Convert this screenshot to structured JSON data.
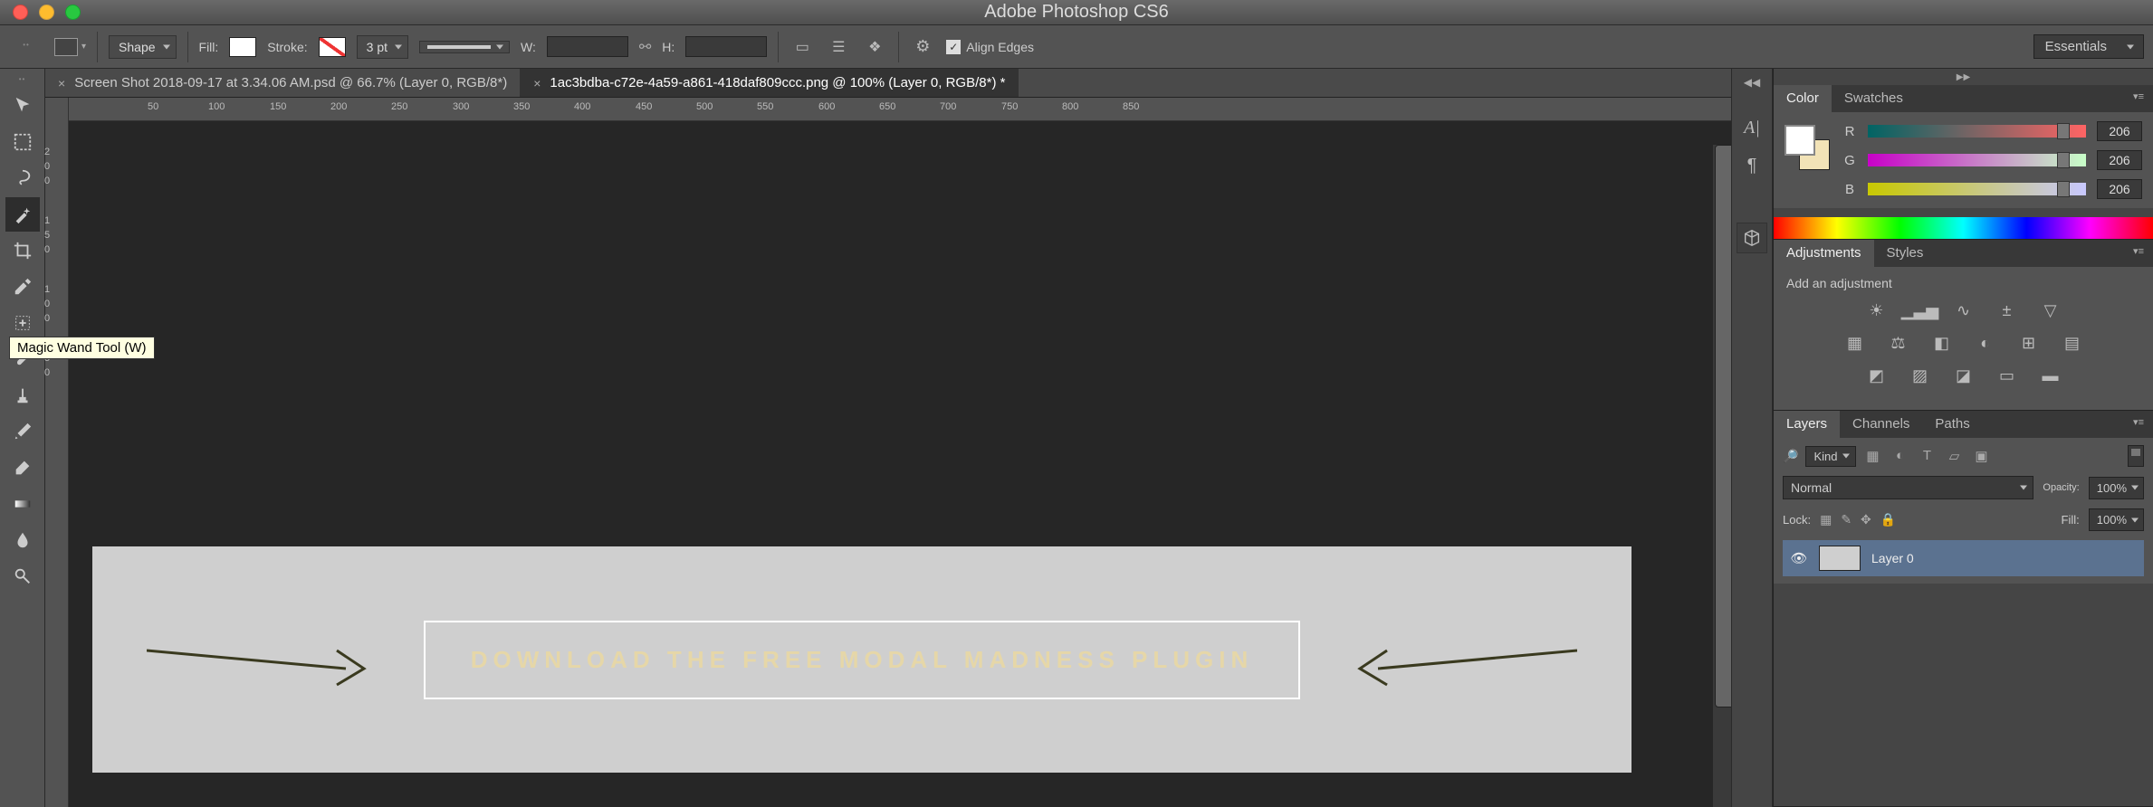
{
  "titlebar": {
    "title": "Adobe Photoshop CS6"
  },
  "options": {
    "shape_label": "Shape",
    "fill_label": "Fill:",
    "stroke_label": "Stroke:",
    "stroke_width": "3 pt",
    "w_label": "W:",
    "h_label": "H:",
    "align_edges": "Align Edges",
    "workspace": "Essentials"
  },
  "tabs": [
    {
      "label": "Screen Shot 2018-09-17 at 3.34.06 AM.psd @ 66.7% (Layer 0, RGB/8*)",
      "active": false
    },
    {
      "label": "1ac3bdba-c72e-4a59-a861-418daf809ccc.png @ 100% (Layer 0, RGB/8*) *",
      "active": true
    }
  ],
  "hruler_ticks": [
    "50",
    "100",
    "150",
    "200",
    "250",
    "300",
    "350",
    "400",
    "450",
    "500",
    "550",
    "600",
    "650",
    "700",
    "750",
    "800",
    "850"
  ],
  "vruler_ticks": [
    "2",
    "0",
    "0",
    "1",
    "5",
    "0",
    "1",
    "0",
    "0",
    "5",
    "0"
  ],
  "tooltip": "Magic Wand Tool (W)",
  "canvas": {
    "button_text": "DOWNLOAD THE FREE MODAL MADNESS PLUGIN"
  },
  "color_panel": {
    "tab_color": "Color",
    "tab_swatches": "Swatches",
    "r_label": "R",
    "g_label": "G",
    "b_label": "B",
    "r_val": "206",
    "g_val": "206",
    "b_val": "206"
  },
  "adjustments_panel": {
    "tab_adjustments": "Adjustments",
    "tab_styles": "Styles",
    "title": "Add an adjustment"
  },
  "layers_panel": {
    "tab_layers": "Layers",
    "tab_channels": "Channels",
    "tab_paths": "Paths",
    "kind_label": "Kind",
    "blend_mode": "Normal",
    "opacity_label": "Opacity:",
    "opacity_val": "100%",
    "lock_label": "Lock:",
    "fill_label": "Fill:",
    "fill_val": "100%",
    "layer0": "Layer 0"
  }
}
